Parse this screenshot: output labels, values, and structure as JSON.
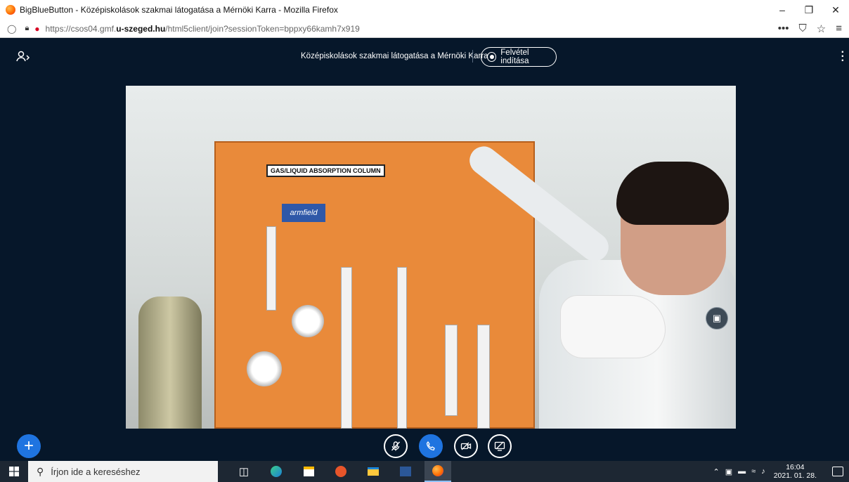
{
  "browser": {
    "window_title": "BigBlueButton - Középiskolások szakmai látogatása a Mérnöki Karra - Mozilla Firefox",
    "url_prefix": "https://csos04.gmf.",
    "url_domain": "u-szeged.hu",
    "url_path": "/html5client/join?sessionToken=bppxy66kamh7x919",
    "win_minimize": "–",
    "win_restore": "❐",
    "win_close": "✕",
    "menu_dots": "•••",
    "pocket": "⛉",
    "bookmark": "☆",
    "hamburger": "≡"
  },
  "meeting": {
    "title": "Középiskolások szakmai látogatása a Mérnöki Karra",
    "record_label": "Felvétel indítása"
  },
  "video": {
    "panel_label": "GAS/LIQUID ABSORPTION COLUMN",
    "brand_label": "armfield"
  },
  "taskbar": {
    "search_placeholder": "Írjon ide a kereséshez",
    "time": "16:04",
    "date": "2021. 01. 28."
  }
}
